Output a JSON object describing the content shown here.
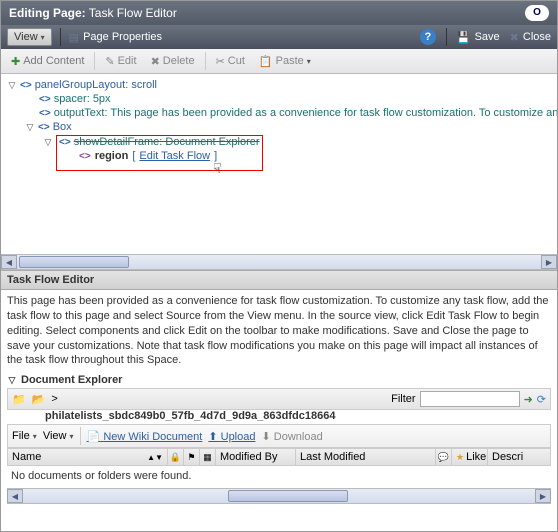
{
  "title_bar": {
    "prefix": "Editing Page:",
    "name": "Task Flow Editor"
  },
  "menu": {
    "view": "View",
    "page_properties": "Page Properties",
    "save": "Save",
    "close": "Close"
  },
  "toolbar": {
    "add_content": "Add Content",
    "edit": "Edit",
    "delete": "Delete",
    "cut": "Cut",
    "paste": "Paste"
  },
  "tree": {
    "panel_group": "panelGroupLayout: scroll",
    "spacer": "spacer: 5px",
    "output_text": "outputText: This page has been provided as a convenience for task flow customization. To customize any",
    "box": "Box",
    "show_detail": "showDetailFrame: Document Explorer",
    "region": "region",
    "edit_link": "Edit Task Flow",
    "bracket_open": "[",
    "bracket_close": "]"
  },
  "section": {
    "title": "Task Flow Editor"
  },
  "description": "This page has been provided as a convenience for task flow customization. To customize any task flow, add the task flow to this page and select Source from the View menu. In the source view, click Edit Task Flow to begin editing. Select components and click Edit on the toolbar to make modifications. Save and Close the page to save your customizations. Note that task flow modifications you make on this page will impact all instances of the task flow throughout this Space.",
  "doc_explorer": {
    "header": "Document Explorer",
    "breadcrumb_sep": ">",
    "path": "philatelists_sbdc849b0_57fb_4d7d_9d9a_863dfdc18664",
    "filter_label": "Filter",
    "file_menu": "File",
    "view_menu": "View",
    "new_wiki": "New Wiki Document",
    "upload": "Upload",
    "download": "Download",
    "columns": {
      "name": "Name",
      "modified_by": "Modified By",
      "last_modified": "Last Modified",
      "like": "Like",
      "descr": "Descri"
    },
    "empty": "No documents or folders were found."
  }
}
